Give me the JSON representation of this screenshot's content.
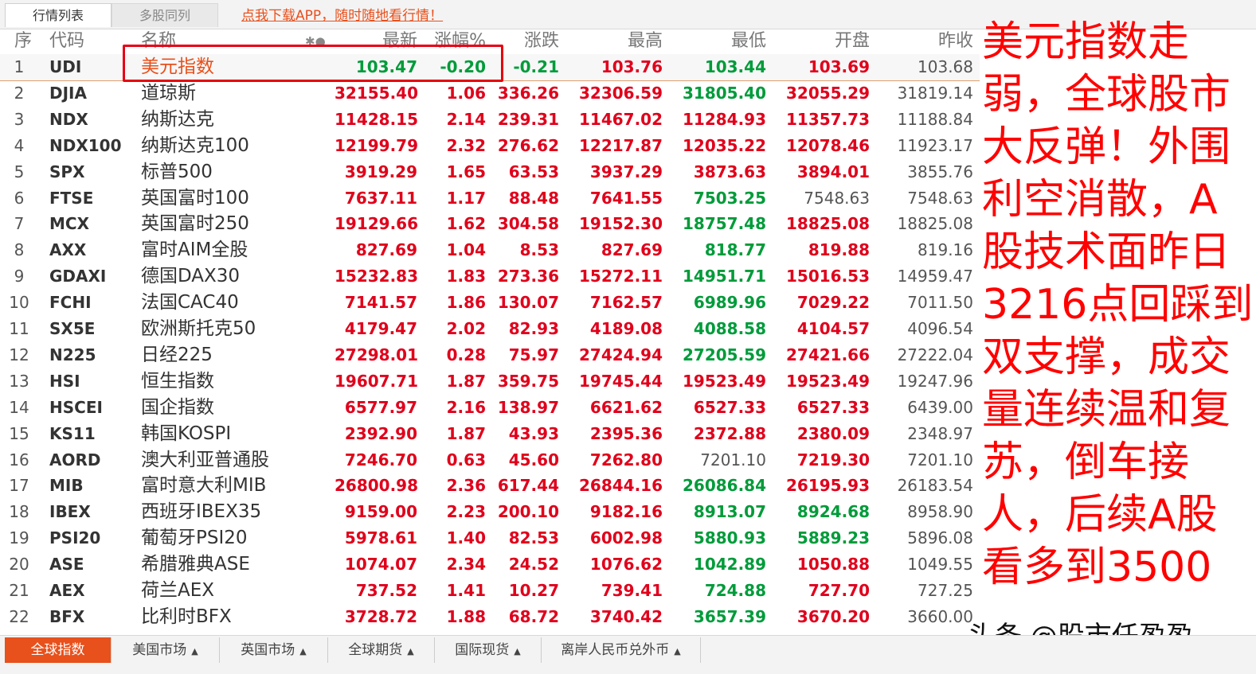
{
  "top_tabs": [
    "行情列表",
    "多股同列"
  ],
  "promo_link": "点我下载APP，随时随地看行情！",
  "columns": [
    "序",
    "代码",
    "名称",
    "最新",
    "涨幅%",
    "涨跌",
    "最高",
    "最低",
    "开盘",
    "昨收"
  ],
  "star_icon_glyph": "✱●",
  "rows": [
    [
      "1",
      "UDI",
      "美元指数",
      "103.47",
      "-0.20",
      "-0.21",
      "103.76",
      "103.44",
      "103.69",
      "103.68"
    ],
    [
      "2",
      "DJIA",
      "道琼斯",
      "32155.40",
      "1.06",
      "336.26",
      "32306.59",
      "31805.40",
      "32055.29",
      "31819.14"
    ],
    [
      "3",
      "NDX",
      "纳斯达克",
      "11428.15",
      "2.14",
      "239.31",
      "11467.02",
      "11284.93",
      "11357.73",
      "11188.84"
    ],
    [
      "4",
      "NDX100",
      "纳斯达克100",
      "12199.79",
      "2.32",
      "276.62",
      "12217.87",
      "12035.22",
      "12078.46",
      "11923.17"
    ],
    [
      "5",
      "SPX",
      "标普500",
      "3919.29",
      "1.65",
      "63.53",
      "3937.29",
      "3873.63",
      "3894.01",
      "3855.76"
    ],
    [
      "6",
      "FTSE",
      "英国富时100",
      "7637.11",
      "1.17",
      "88.48",
      "7641.55",
      "7503.25",
      "7548.63",
      "7548.63"
    ],
    [
      "7",
      "MCX",
      "英国富时250",
      "19129.66",
      "1.62",
      "304.58",
      "19152.30",
      "18757.48",
      "18825.08",
      "18825.08"
    ],
    [
      "8",
      "AXX",
      "富时AIM全股",
      "827.69",
      "1.04",
      "8.53",
      "827.69",
      "818.77",
      "819.88",
      "819.16"
    ],
    [
      "9",
      "GDAXI",
      "德国DAX30",
      "15232.83",
      "1.83",
      "273.36",
      "15272.11",
      "14951.71",
      "15016.53",
      "14959.47"
    ],
    [
      "10",
      "FCHI",
      "法国CAC40",
      "7141.57",
      "1.86",
      "130.07",
      "7162.57",
      "6989.96",
      "7029.22",
      "7011.50"
    ],
    [
      "11",
      "SX5E",
      "欧洲斯托克50",
      "4179.47",
      "2.02",
      "82.93",
      "4189.08",
      "4088.58",
      "4104.57",
      "4096.54"
    ],
    [
      "12",
      "N225",
      "日经225",
      "27298.01",
      "0.28",
      "75.97",
      "27424.94",
      "27205.59",
      "27421.66",
      "27222.04"
    ],
    [
      "13",
      "HSI",
      "恒生指数",
      "19607.71",
      "1.87",
      "359.75",
      "19745.44",
      "19523.49",
      "19523.49",
      "19247.96"
    ],
    [
      "14",
      "HSCEI",
      "国企指数",
      "6577.97",
      "2.16",
      "138.97",
      "6621.62",
      "6527.33",
      "6527.33",
      "6439.00"
    ],
    [
      "15",
      "KS11",
      "韩国KOSPI",
      "2392.90",
      "1.87",
      "43.93",
      "2395.36",
      "2372.88",
      "2380.09",
      "2348.97"
    ],
    [
      "16",
      "AORD",
      "澳大利亚普通股",
      "7246.70",
      "0.63",
      "45.60",
      "7262.80",
      "7201.10",
      "7219.30",
      "7201.10"
    ],
    [
      "17",
      "MIB",
      "富时意大利MIB",
      "26800.98",
      "2.36",
      "617.44",
      "26844.16",
      "26086.84",
      "26195.93",
      "26183.54"
    ],
    [
      "18",
      "IBEX",
      "西班牙IBEX35",
      "9159.00",
      "2.23",
      "200.10",
      "9182.16",
      "8913.07",
      "8924.68",
      "8958.90"
    ],
    [
      "19",
      "PSI20",
      "葡萄牙PSI20",
      "5978.61",
      "1.40",
      "82.53",
      "6002.98",
      "5880.93",
      "5889.23",
      "5896.08"
    ],
    [
      "20",
      "ASE",
      "希腊雅典ASE",
      "1074.07",
      "2.34",
      "24.52",
      "1076.62",
      "1042.89",
      "1050.88",
      "1049.55"
    ],
    [
      "21",
      "AEX",
      "荷兰AEX",
      "737.52",
      "1.41",
      "10.27",
      "739.41",
      "724.88",
      "727.70",
      "727.25"
    ],
    [
      "22",
      "BFX",
      "比利时BFX",
      "3728.72",
      "1.88",
      "68.72",
      "3740.42",
      "3657.39",
      "3670.20",
      "3660.00"
    ]
  ],
  "row_colors": [
    [
      "green",
      "green",
      "green",
      "red",
      "green",
      "red",
      "dark"
    ],
    [
      "red",
      "red",
      "red",
      "red",
      "green",
      "red",
      "dark"
    ],
    [
      "red",
      "red",
      "red",
      "red",
      "red",
      "red",
      "dark"
    ],
    [
      "red",
      "red",
      "red",
      "red",
      "red",
      "red",
      "dark"
    ],
    [
      "red",
      "red",
      "red",
      "red",
      "red",
      "red",
      "dark"
    ],
    [
      "red",
      "red",
      "red",
      "red",
      "green",
      "dark",
      "dark"
    ],
    [
      "red",
      "red",
      "red",
      "red",
      "green",
      "red",
      "dark"
    ],
    [
      "red",
      "red",
      "red",
      "red",
      "green",
      "red",
      "dark"
    ],
    [
      "red",
      "red",
      "red",
      "red",
      "green",
      "red",
      "dark"
    ],
    [
      "red",
      "red",
      "red",
      "red",
      "green",
      "red",
      "dark"
    ],
    [
      "red",
      "red",
      "red",
      "red",
      "green",
      "red",
      "dark"
    ],
    [
      "red",
      "red",
      "red",
      "red",
      "green",
      "red",
      "dark"
    ],
    [
      "red",
      "red",
      "red",
      "red",
      "red",
      "red",
      "dark"
    ],
    [
      "red",
      "red",
      "red",
      "red",
      "red",
      "red",
      "dark"
    ],
    [
      "red",
      "red",
      "red",
      "red",
      "red",
      "red",
      "dark"
    ],
    [
      "red",
      "red",
      "red",
      "red",
      "dark",
      "red",
      "dark"
    ],
    [
      "red",
      "red",
      "red",
      "red",
      "green",
      "red",
      "dark"
    ],
    [
      "red",
      "red",
      "red",
      "red",
      "green",
      "green",
      "dark"
    ],
    [
      "red",
      "red",
      "red",
      "red",
      "green",
      "green",
      "dark"
    ],
    [
      "red",
      "red",
      "red",
      "red",
      "green",
      "red",
      "dark"
    ],
    [
      "red",
      "red",
      "red",
      "red",
      "green",
      "red",
      "dark"
    ],
    [
      "red",
      "red",
      "red",
      "red",
      "green",
      "red",
      "dark"
    ]
  ],
  "overlay_text": [
    "美元指数走",
    "弱，全球股市",
    "大反弹！外围",
    "利空消散，A",
    "股技术面昨日",
    "3216点回踩到",
    "双支撑，成交",
    "量连续温和复",
    "苏，倒车接",
    "人，后续A股",
    "看多到3500"
  ],
  "watermark": "头条 @股市任盈盈",
  "bottom_tabs": [
    "全球指数",
    "美国市场",
    "英国市场",
    "全球期货",
    "国际现货",
    "离岸人民币兑外币"
  ],
  "colors": {
    "accent": "#e8501c",
    "up": "#e0001b",
    "down": "#009b3a",
    "highlight": "#e60012"
  }
}
